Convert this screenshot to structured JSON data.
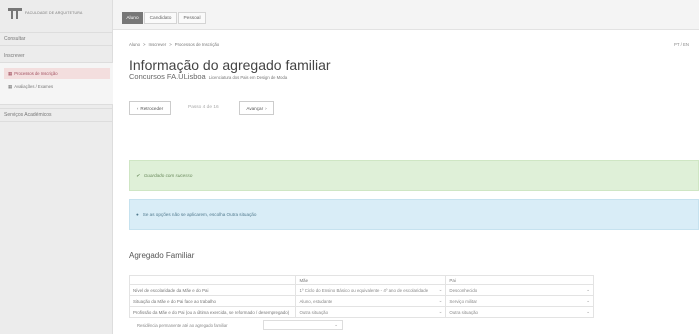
{
  "sidebar": {
    "logo_text": "FACULDADE DE ARQUITETURA",
    "consultar": "Consultar",
    "inscrever": "Inscrever",
    "sub_items": [
      {
        "label": "Processos de Inscrição",
        "icon": "grid-icon"
      },
      {
        "label": "Avaliações / Exames",
        "icon": "grid-icon"
      }
    ],
    "servicos": "Serviços Académicos"
  },
  "tabs": [
    {
      "label": "Aluno",
      "active": true
    },
    {
      "label": "Candidato",
      "active": false
    },
    {
      "label": "Pessoal",
      "active": false
    }
  ],
  "breadcrumb": {
    "items": [
      "Aluno",
      "Inscrever",
      "Processos de Inscrição"
    ],
    "separator": ">"
  },
  "lang": "PT / EN",
  "page": {
    "title": "Informação do agregado familiar",
    "subtitle": "Concursos FA.ULisboa",
    "subtitle_small": "Licenciatura dos Pais em Design de Moda"
  },
  "nav": {
    "back_label": "Retroceder",
    "step_text": "Passo 4 de 16",
    "next_label": "Avançar"
  },
  "alerts": {
    "success": "Guardado com sucesso",
    "info": "Se as opções não se aplicarem, escolha Outra situação"
  },
  "section_title": "Agregado Familiar",
  "table": {
    "headers": [
      "",
      "Mãe",
      "Pai"
    ],
    "rows": [
      {
        "label": "Nível de escolaridade da Mãe e do Pai",
        "mae": "1º Ciclo do Ensino Básico ou equivalente - 4º ano de escolaridade",
        "pai": "Desconhecido"
      },
      {
        "label": "Situação da Mãe e do Pai face ao trabalho",
        "mae": "Aluno, estudante",
        "pai": "Serviço militar"
      },
      {
        "label": "Profissão da Mãe e do Pai (ou a última exercida, se reformado / desempregado)",
        "mae": "Outra situação",
        "pai": "Outra situação"
      }
    ]
  },
  "footer": {
    "label": "Residência permanente até ao agregado familiar",
    "select_value": ""
  },
  "colors": {
    "success_bg": "#dff0d8",
    "info_bg": "#d9edf7",
    "active_tab": "#777777",
    "active_menu_bg": "#f3dede"
  }
}
